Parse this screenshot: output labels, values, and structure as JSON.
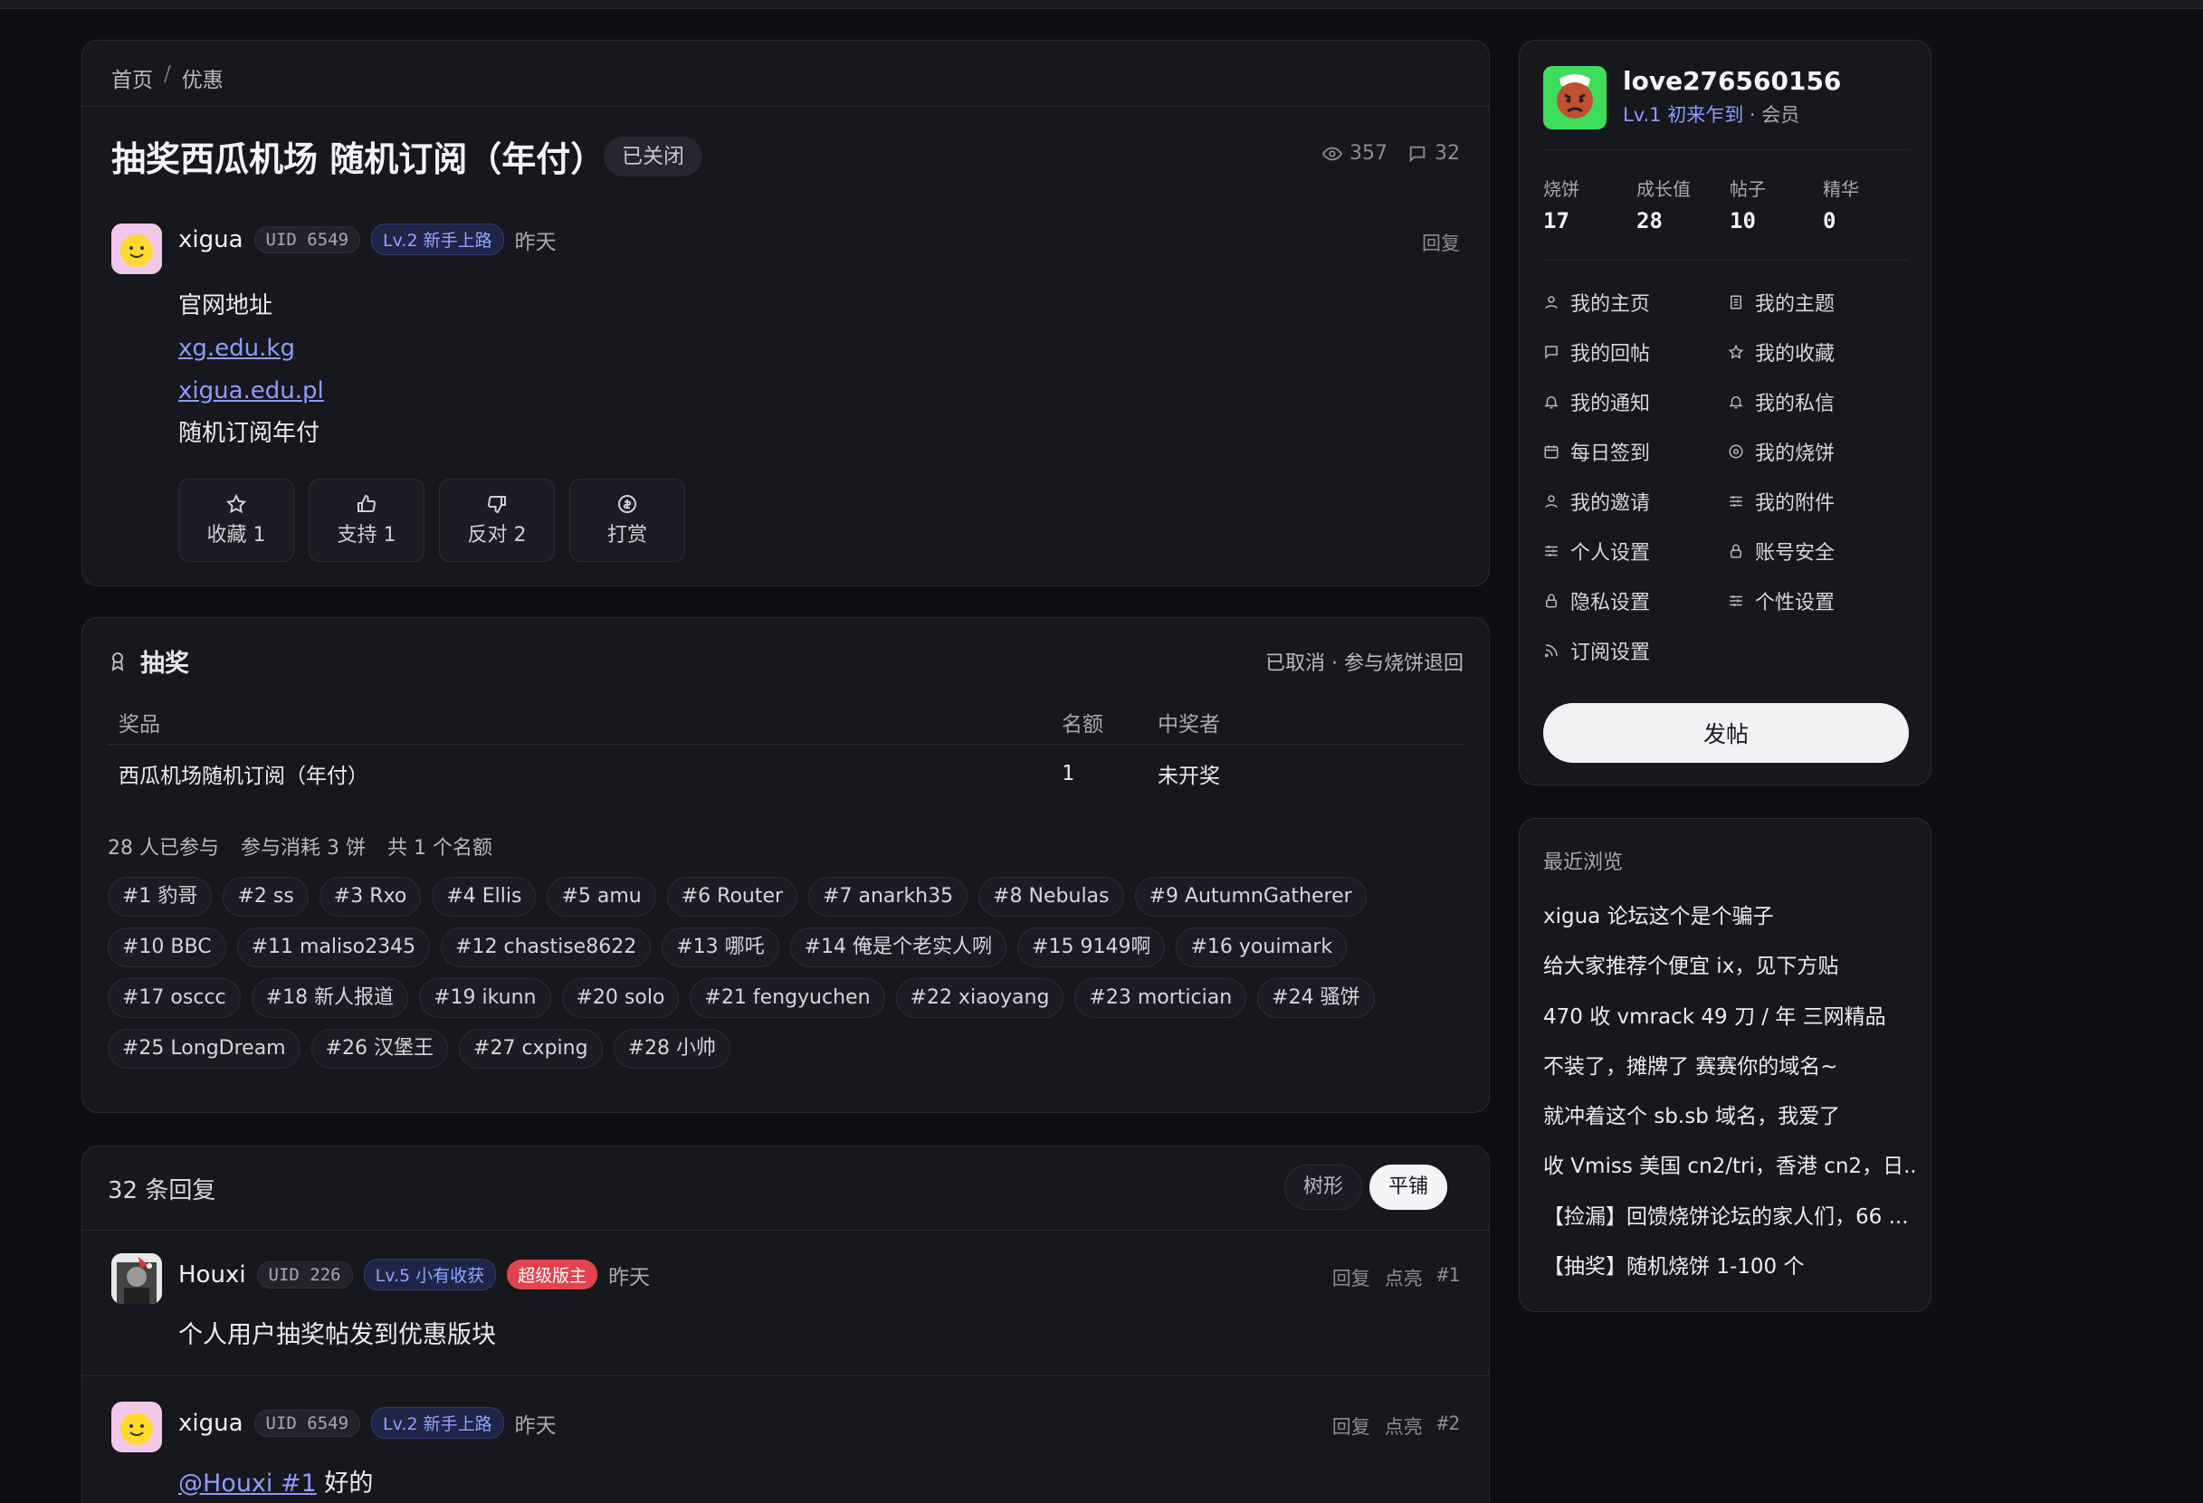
{
  "breadcrumb": {
    "home": "首页",
    "sep": "/",
    "current": "优惠"
  },
  "post": {
    "title": "抽奖西瓜机场 随机订阅（年付）",
    "status_badge": "已关闭",
    "views": "357",
    "comments": "32",
    "author": {
      "name": "xigua",
      "uid": "UID 6549",
      "level": "Lv.2 新手上路",
      "time": "昨天"
    },
    "reply_label": "回复",
    "body": {
      "line1": "官网地址",
      "link1": "xg.edu.kg",
      "link2": "xigua.edu.pl",
      "line2": "随机订阅年付"
    },
    "actions": [
      {
        "label": "收藏 1",
        "icon": "star-icon"
      },
      {
        "label": "支持 1",
        "icon": "thumbs-up-icon"
      },
      {
        "label": "反对 2",
        "icon": "thumbs-down-icon"
      },
      {
        "label": "打赏",
        "icon": "coin-icon"
      }
    ]
  },
  "lottery": {
    "title": "抽奖",
    "status": "已取消 · 参与烧饼退回",
    "headers": {
      "prize": "奖品",
      "quota": "名额",
      "winner": "中奖者"
    },
    "row": {
      "prize": "西瓜机场随机订阅（年付）",
      "quota": "1",
      "winner": "未开奖"
    },
    "summary": {
      "participants": "28 人已参与",
      "cost": "参与消耗 3 饼",
      "total": "共 1 个名额"
    },
    "entries": [
      "#1 豹哥",
      "#2 ss",
      "#3 Rxo",
      "#4 Ellis",
      "#5 amu",
      "#6 Router",
      "#7 anarkh35",
      "#8 Nebulas",
      "#9 AutumnGatherer",
      "#10 BBC",
      "#11 maliso2345",
      "#12 chastise8622",
      "#13 哪吒",
      "#14 俺是个老实人咧",
      "#15 9149啊",
      "#16 youimark",
      "#17 osccc",
      "#18 新人报道",
      "#19 ikunn",
      "#20 solo",
      "#21 fengyuchen",
      "#22 xiaoyang",
      "#23 mortician",
      "#24 骚饼",
      "#25 LongDream",
      "#26 汉堡王",
      "#27 cxping",
      "#28 小帅"
    ]
  },
  "replies": {
    "count": "32 条回复",
    "view_tree": "树形",
    "view_flat": "平铺",
    "reply_label": "回复",
    "like_label": "点亮",
    "items": [
      {
        "name": "Houxi",
        "uid": "UID 226",
        "level": "Lv.5 小有收获",
        "badge": "超级版主",
        "time": "昨天",
        "floor": "#1",
        "text": "个人用户抽奖帖发到优惠版块"
      },
      {
        "name": "xigua",
        "uid": "UID 6549",
        "level": "Lv.2 新手上路",
        "time": "昨天",
        "floor": "#2",
        "mention": "@Houxi #1",
        "text": " 好的"
      }
    ]
  },
  "user": {
    "name": "love276560156",
    "level": "Lv.1 初来乍到",
    "role": " · 会员",
    "stats": [
      {
        "k": "烧饼",
        "v": "17"
      },
      {
        "k": "成长值",
        "v": "28"
      },
      {
        "k": "帖子",
        "v": "10"
      },
      {
        "k": "精华",
        "v": "0"
      }
    ],
    "menu": [
      "我的主页",
      "我的主题",
      "我的回帖",
      "我的收藏",
      "我的通知",
      "我的私信",
      "每日签到",
      "我的烧饼",
      "我的邀请",
      "我的附件",
      "个人设置",
      "账号安全",
      "隐私设置",
      "个性设置",
      "订阅设置"
    ],
    "post_button": "发帖"
  },
  "recent": {
    "title": "最近浏览",
    "items": [
      "xigua 论坛这个是个骗子",
      "给大家推荐个便宜 ix，见下方贴",
      "470 收 vmrack 49 刀 / 年 三网精品",
      "不装了，摊牌了 赛赛你的域名~",
      "就冲着这个 sb.sb 域名，我爱了",
      "收 Vmiss 美国 cn2/tri，香港 cn2，日...",
      "【捡漏】回馈烧饼论坛的家人们，66 ...",
      "【抽奖】随机烧饼 1-100 个"
    ]
  },
  "colors": {
    "accent": "#8d9cff",
    "danger": "#e3434f",
    "bg": "#0f0f13",
    "card": "#17171e"
  }
}
